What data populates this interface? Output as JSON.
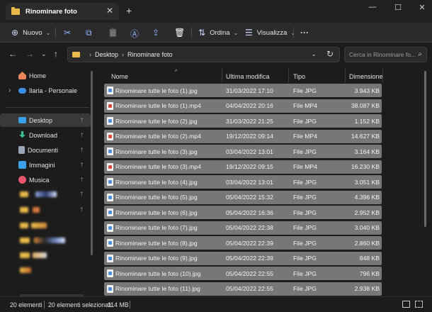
{
  "window": {
    "tab_title": "Rinominare foto",
    "tab_close": "✕",
    "new_tab": "+",
    "min": "—",
    "max": "☐",
    "close": "✕"
  },
  "toolbar": {
    "new_label": "Nuovo",
    "new_glyph": "⊕",
    "sort_label": "Ordina",
    "sort_glyph": "⇅",
    "view_label": "Visualizza",
    "view_glyph": "☰",
    "more": "···",
    "cut": "✂",
    "copy": "⧉",
    "paste": "📋",
    "rename": "Ⓐ",
    "share": "⇪",
    "delete": "🗑",
    "chev": "⌄"
  },
  "nav": {
    "back": "←",
    "forward": "→",
    "recent": "⌄",
    "up": "↑"
  },
  "address": {
    "separator": "›",
    "crumbs": [
      "Desktop",
      "Rinominare foto"
    ],
    "dropdown": "⌄",
    "refresh": "↻"
  },
  "search": {
    "placeholder": "Cerca in Rinominare fo...",
    "glyph": "⌕"
  },
  "sidebar": {
    "items": [
      {
        "label": "Home",
        "icon_color": "#e9865a",
        "icon": "home-icon"
      },
      {
        "label": "Ilaria - Personale",
        "icon_color": "#3a8ee6",
        "icon": "cloud-icon"
      },
      {
        "label": "Desktop",
        "icon_color": "#3aa0e8",
        "icon": "desktop-icon"
      },
      {
        "label": "Download",
        "icon_color": "#3cbf8a",
        "icon": "download-icon"
      },
      {
        "label": "Documenti",
        "icon_color": "#9aa6b8",
        "icon": "documents-icon"
      },
      {
        "label": "Immagini",
        "icon_color": "#3aa0e8",
        "icon": "pictures-icon"
      },
      {
        "label": "Musica",
        "icon_color": "#e8556e",
        "icon": "music-icon"
      }
    ],
    "pin": "📌",
    "expand": "›"
  },
  "columns": {
    "name": "Nome",
    "modified": "Ultima modifica",
    "type": "Tipo",
    "size": "Dimensione",
    "sort_caret": "^"
  },
  "files": [
    {
      "name": "Rinominare tutte le foto  (1).jpg",
      "date": "31/03/2022 17:10",
      "type": "File JPG",
      "size": "3.943 KB",
      "kind": "jpg"
    },
    {
      "name": "Rinominare tutte le foto  (1).mp4",
      "date": "04/04/2022 20:16",
      "type": "File MP4",
      "size": "38.087 KB",
      "kind": "mp4"
    },
    {
      "name": "Rinominare tutte le foto  (2).jpg",
      "date": "31/03/2022 21:25",
      "type": "File JPG",
      "size": "1.152 KB",
      "kind": "jpg"
    },
    {
      "name": "Rinominare tutte le foto  (2).mp4",
      "date": "19/12/2022 09:14",
      "type": "File MP4",
      "size": "14.627 KB",
      "kind": "mp4"
    },
    {
      "name": "Rinominare tutte le foto  (3).jpg",
      "date": "03/04/2022 13:01",
      "type": "File JPG",
      "size": "3.164 KB",
      "kind": "jpg"
    },
    {
      "name": "Rinominare tutte le foto  (3).mp4",
      "date": "19/12/2022 09:15",
      "type": "File MP4",
      "size": "16.230 KB",
      "kind": "mp4"
    },
    {
      "name": "Rinominare tutte le foto  (4).jpg",
      "date": "03/04/2022 13:01",
      "type": "File JPG",
      "size": "3.051 KB",
      "kind": "jpg"
    },
    {
      "name": "Rinominare tutte le foto  (5).jpg",
      "date": "05/04/2022 15:32",
      "type": "File JPG",
      "size": "4.396 KB",
      "kind": "jpg"
    },
    {
      "name": "Rinominare tutte le foto  (6).jpg",
      "date": "05/04/2022 16:36",
      "type": "File JPG",
      "size": "2.952 KB",
      "kind": "jpg"
    },
    {
      "name": "Rinominare tutte le foto  (7).jpg",
      "date": "05/04/2022 22:38",
      "type": "File JPG",
      "size": "3.040 KB",
      "kind": "jpg"
    },
    {
      "name": "Rinominare tutte le foto  (8).jpg",
      "date": "05/04/2022 22:39",
      "type": "File JPG",
      "size": "2.860 KB",
      "kind": "jpg"
    },
    {
      "name": "Rinominare tutte le foto  (9).jpg",
      "date": "05/04/2022 22:39",
      "type": "File JPG",
      "size": "848 KB",
      "kind": "jpg"
    },
    {
      "name": "Rinominare tutte le foto  (10).jpg",
      "date": "05/04/2022 22:55",
      "type": "File JPG",
      "size": "796 KB",
      "kind": "jpg"
    },
    {
      "name": "Rinominare tutte le foto  (11).jpg",
      "date": "05/04/2022 22:55",
      "type": "File JPG",
      "size": "2.938 KB",
      "kind": "jpg"
    }
  ],
  "status": {
    "count": "20 elementi",
    "selected": "20 elementi selezionati",
    "size": "114 MB"
  }
}
